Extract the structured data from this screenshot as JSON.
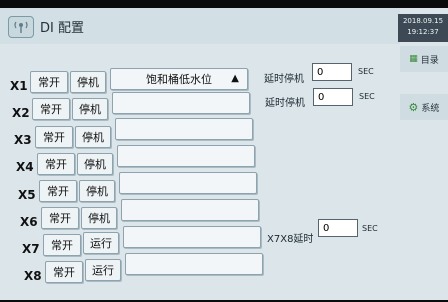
{
  "header": {
    "title": "DI 配置"
  },
  "clock": {
    "date": "2018.09.15",
    "time": "19:12:37"
  },
  "side_nav": {
    "menu_label": "目录",
    "system_label": "系统"
  },
  "rows": [
    {
      "id": "X1",
      "mode": "常开",
      "action": "停机",
      "desc": "饱和桶低水位"
    },
    {
      "id": "X2",
      "mode": "常开",
      "action": "停机",
      "desc": ""
    },
    {
      "id": "X3",
      "mode": "常开",
      "action": "停机",
      "desc": ""
    },
    {
      "id": "X4",
      "mode": "常开",
      "action": "停机",
      "desc": ""
    },
    {
      "id": "X5",
      "mode": "常开",
      "action": "停机",
      "desc": ""
    },
    {
      "id": "X6",
      "mode": "常开",
      "action": "停机",
      "desc": ""
    },
    {
      "id": "X7",
      "mode": "常开",
      "action": "运行",
      "desc": ""
    },
    {
      "id": "X8",
      "mode": "常开",
      "action": "运行",
      "desc": ""
    }
  ],
  "delays": [
    {
      "label": "延时停机",
      "value": "0",
      "unit": "SEC"
    },
    {
      "label": "延时停机",
      "value": "0",
      "unit": "SEC"
    }
  ],
  "x7x8_delay": {
    "label": "X7X8延时",
    "value": "0",
    "unit": "SEC"
  }
}
